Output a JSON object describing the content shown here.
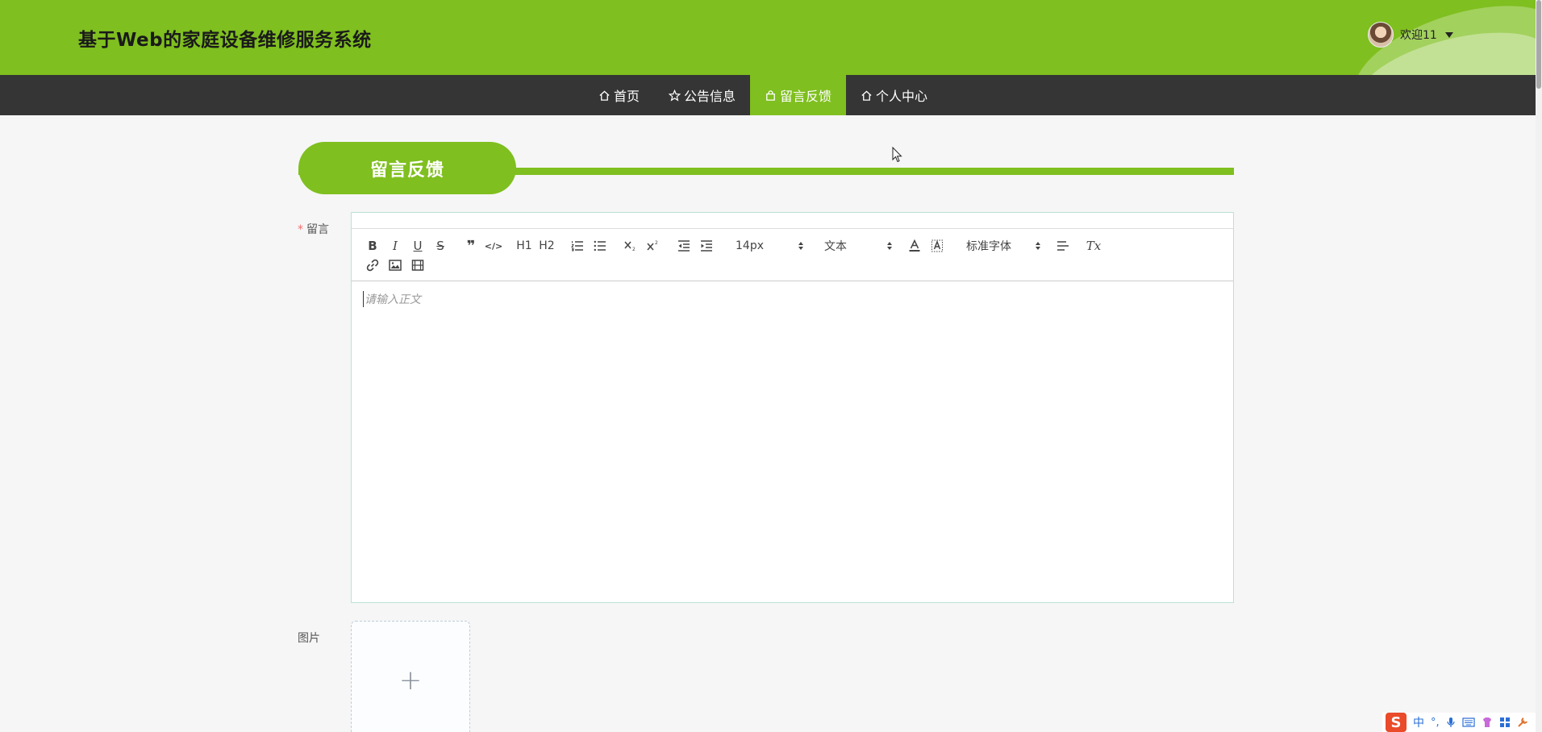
{
  "header": {
    "title": "基于Web的家庭设备维修服务系统",
    "user_label": "欢迎11"
  },
  "nav": {
    "items": [
      {
        "label": "首页",
        "icon": "home-icon"
      },
      {
        "label": "公告信息",
        "icon": "star-icon"
      },
      {
        "label": "留言反馈",
        "icon": "bag-icon",
        "active": true
      },
      {
        "label": "个人中心",
        "icon": "home-icon"
      }
    ]
  },
  "section": {
    "title": "留言反馈"
  },
  "form": {
    "message_label": "留言",
    "required_mark": "*",
    "image_label": "图片",
    "editor": {
      "placeholder": "请输入正文",
      "font_size": "14px",
      "header_type": "文本",
      "font_family": "标准字体",
      "buttons": {
        "bold": "B",
        "italic": "I",
        "underline": "U",
        "strike": "S",
        "blockquote": "❞",
        "code": "</>",
        "h1": "H1",
        "h2": "H2",
        "clear": "Tx"
      }
    },
    "upload_plus": "+"
  },
  "ime": {
    "mode": "中",
    "punct": "°,"
  },
  "colors": {
    "accent": "#7fbf1f",
    "nav_bg": "#353535",
    "page_bg": "#f6f6f6"
  }
}
